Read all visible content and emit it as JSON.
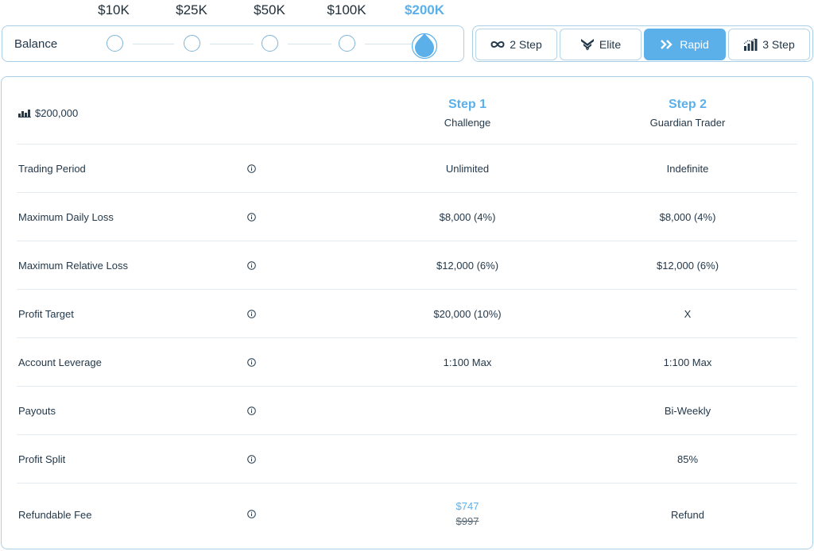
{
  "balance": {
    "label": "Balance",
    "amounts": [
      "$10K",
      "$25K",
      "$50K",
      "$100K",
      "$200K"
    ],
    "selected_index": 4
  },
  "plan_types": [
    {
      "label": "2 Step",
      "icon": "infinity-icon",
      "active": false
    },
    {
      "label": "Elite",
      "icon": "elite-chevron-icon",
      "active": false
    },
    {
      "label": "Rapid",
      "icon": "double-chevron-icon",
      "active": true
    },
    {
      "label": "3 Step",
      "icon": "bar-chart-icon",
      "active": false
    }
  ],
  "table": {
    "account_size": "$200,000",
    "columns": [
      {
        "title": "Step 1",
        "subtitle": "Challenge"
      },
      {
        "title": "Step 2",
        "subtitle": "Guardian Trader"
      }
    ],
    "rows": [
      {
        "label": "Trading Period",
        "step1": "Unlimited",
        "step2": "Indefinite"
      },
      {
        "label": "Maximum Daily Loss",
        "step1": "$8,000 (4%)",
        "step2": "$8,000 (4%)"
      },
      {
        "label": "Maximum Relative Loss",
        "step1": "$12,000 (6%)",
        "step2": "$12,000 (6%)"
      },
      {
        "label": "Profit Target",
        "step1": "$20,000 (10%)",
        "step2": "X"
      },
      {
        "label": "Account Leverage",
        "step1": "1:100 Max",
        "step2": "1:100 Max"
      },
      {
        "label": "Payouts",
        "step1": "",
        "step2": "Bi-Weekly"
      },
      {
        "label": "Profit Split",
        "step1": "",
        "step2": "85%"
      },
      {
        "label": "Refundable Fee",
        "step1_price": "$747",
        "step1_old_price": "$997",
        "step2": "Refund"
      }
    ]
  },
  "colors": {
    "accent": "#5bb0ea",
    "border": "#a9cfe8",
    "text": "#23384a"
  }
}
